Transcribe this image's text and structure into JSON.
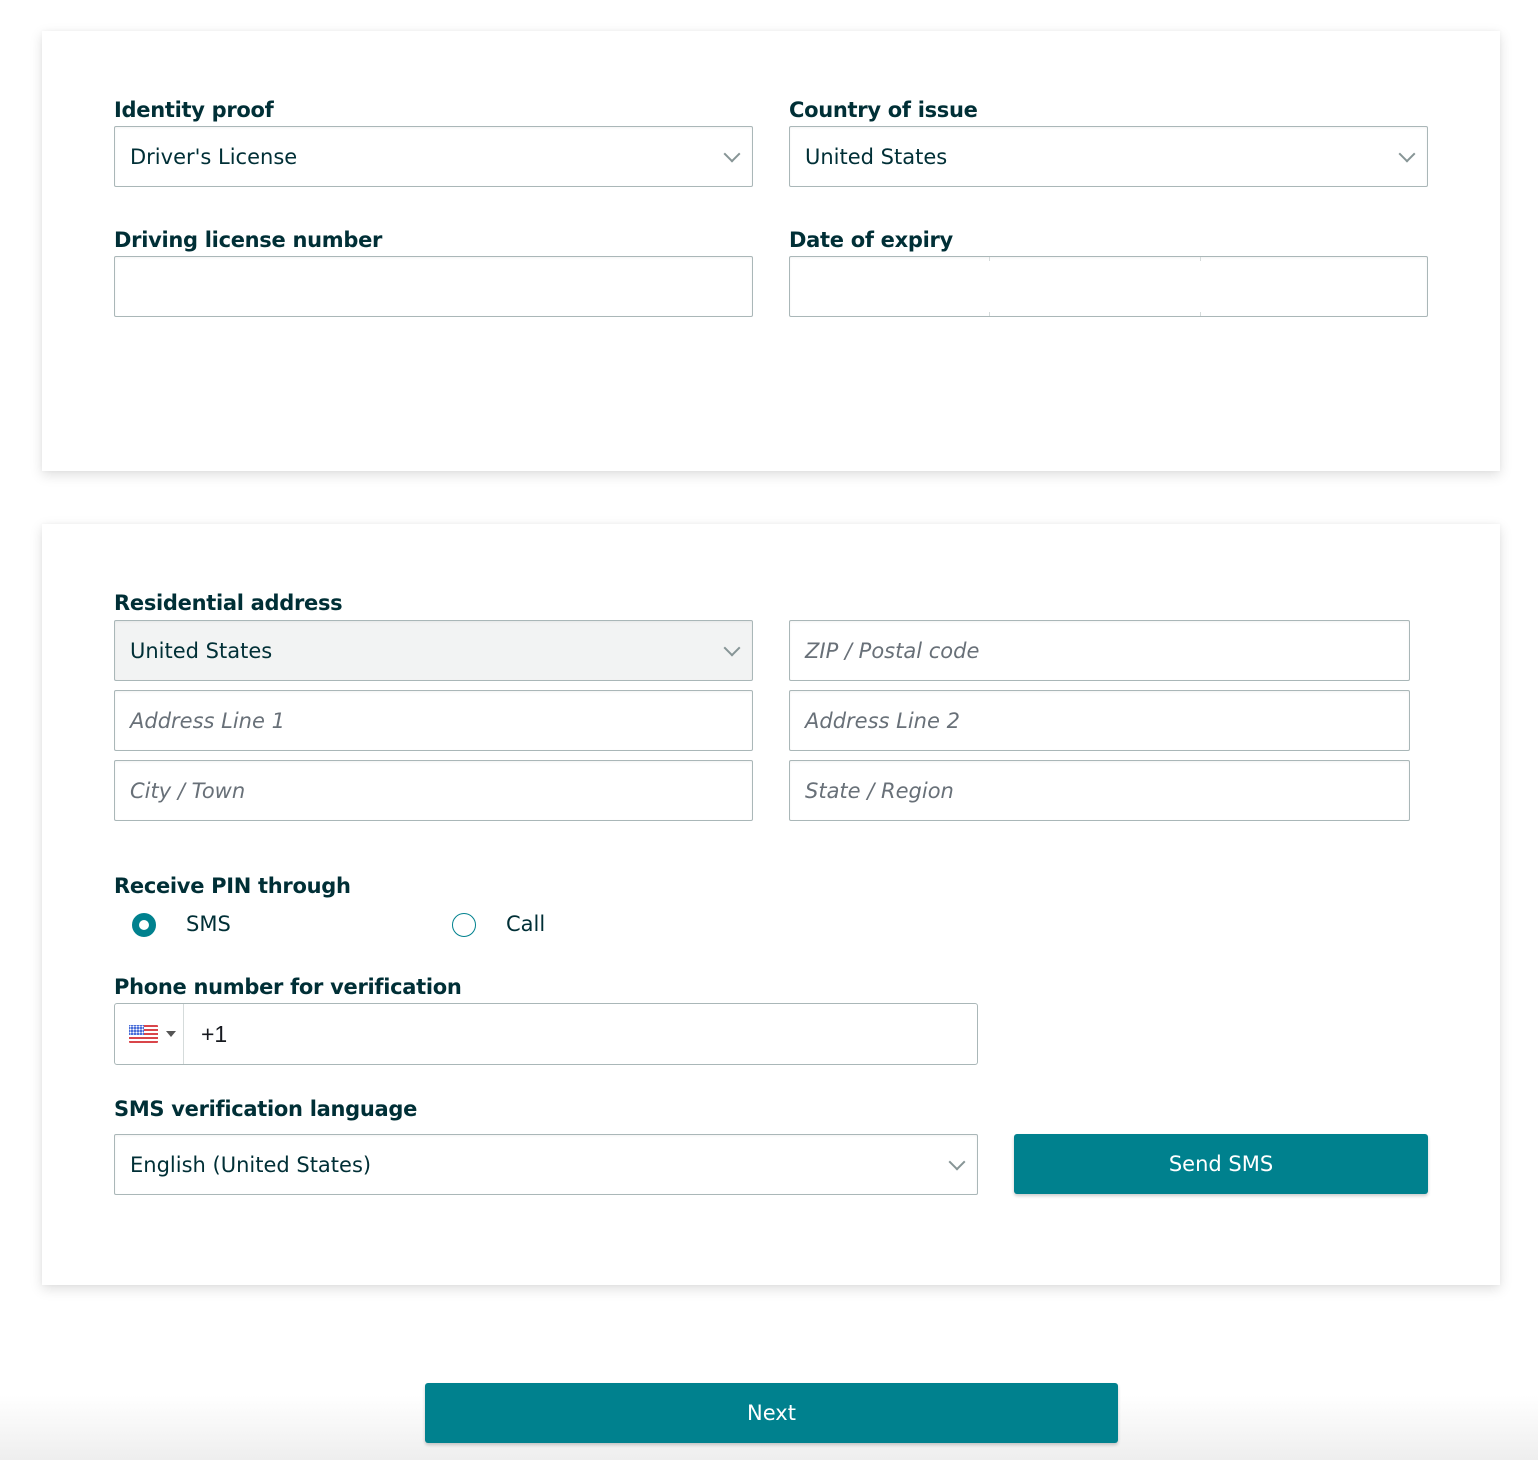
{
  "identity_section": {
    "identity_proof": {
      "label": "Identity proof",
      "value": "Driver's License"
    },
    "country_of_issue": {
      "label": "Country of issue",
      "value": "United States"
    },
    "license_number": {
      "label": "Driving license number",
      "value": ""
    },
    "date_of_expiry": {
      "label": "Date of expiry",
      "day": "",
      "month": "",
      "year": ""
    }
  },
  "address_section": {
    "label": "Residential address",
    "country": "United States",
    "zip_placeholder": "ZIP / Postal code",
    "address_line1_placeholder": "Address Line 1",
    "address_line2_placeholder": "Address Line 2",
    "city_placeholder": "City / Town",
    "state_placeholder": "State / Region"
  },
  "pin_section": {
    "label": "Receive PIN through",
    "options": [
      {
        "label": "SMS",
        "checked": true
      },
      {
        "label": "Call",
        "checked": false
      }
    ]
  },
  "phone_section": {
    "label": "Phone number for verification",
    "country_flag": "us-flag",
    "value": "+1"
  },
  "sms_language": {
    "label": "SMS verification language",
    "value": "English (United States)"
  },
  "buttons": {
    "send_sms": "Send SMS",
    "next": "Next"
  },
  "colors": {
    "primary": "#00818e",
    "text": "#002f36",
    "border": "#aab7b8"
  }
}
